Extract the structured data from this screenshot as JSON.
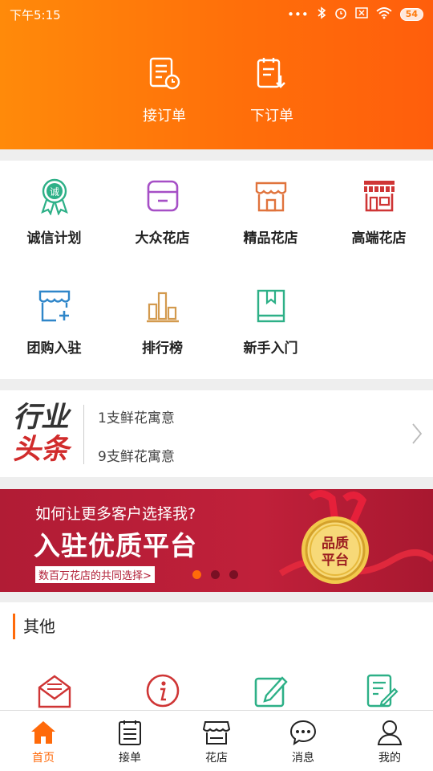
{
  "status": {
    "time": "下午5:15",
    "battery": "54"
  },
  "header": {
    "actions": [
      {
        "label": "接订单",
        "icon": "receive-order-icon"
      },
      {
        "label": "下订单",
        "icon": "place-order-icon"
      }
    ]
  },
  "grid": [
    {
      "label": "诚信计划",
      "icon": "integrity-badge-icon",
      "color": "#2db087"
    },
    {
      "label": "大众花店",
      "icon": "store-icon",
      "color": "#a64fc6"
    },
    {
      "label": "精品花店",
      "icon": "boutique-store-icon",
      "color": "#e0733c"
    },
    {
      "label": "高端花店",
      "icon": "premium-store-icon",
      "color": "#cf3535"
    },
    {
      "label": "团购入驻",
      "icon": "group-buy-icon",
      "color": "#2f86c9"
    },
    {
      "label": "排行榜",
      "icon": "ranking-icon",
      "color": "#d39a4e"
    },
    {
      "label": "新手入门",
      "icon": "guide-book-icon",
      "color": "#2db087"
    }
  ],
  "news": {
    "logo_line1": "行业",
    "logo_line2": "头条",
    "items": [
      "1支鲜花寓意",
      "9支鲜花寓意"
    ]
  },
  "banner": {
    "line1": "如何让更多客户选择我?",
    "line2": "入驻优质平台",
    "tag": "数百万花店的共同选择>",
    "medal_text": "品质平台",
    "dots": 3,
    "active_dot": 0
  },
  "other": {
    "title": "其他",
    "icons": [
      "envelope-icon",
      "info-icon",
      "edit-icon",
      "document-edit-icon"
    ]
  },
  "tabbar": {
    "tabs": [
      {
        "label": "首页",
        "icon": "home-icon",
        "active": true
      },
      {
        "label": "接单",
        "icon": "order-list-icon",
        "active": false
      },
      {
        "label": "花店",
        "icon": "shop-icon",
        "active": false
      },
      {
        "label": "消息",
        "icon": "message-icon",
        "active": false
      },
      {
        "label": "我的",
        "icon": "profile-icon",
        "active": false
      }
    ]
  },
  "colors": {
    "accent": "#ff6a0a",
    "banner": "#b11c35"
  }
}
